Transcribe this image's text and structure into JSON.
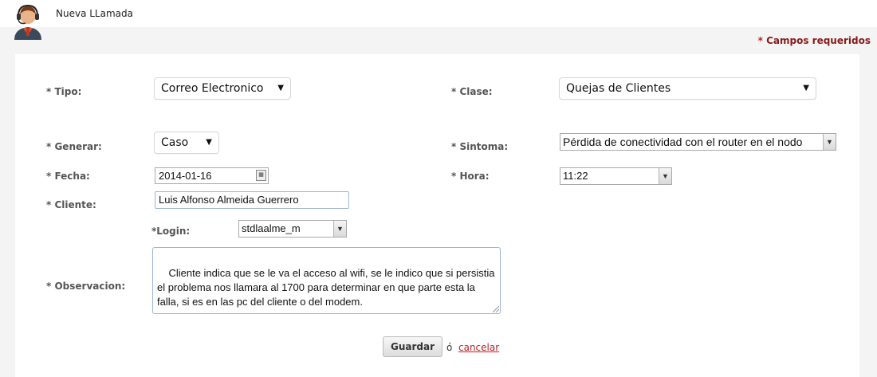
{
  "app": {
    "title": "Nueva LLamada",
    "avatar_icon": "operator-headset-icon"
  },
  "required_note": {
    "star": "*",
    "text": "Campos requeridos"
  },
  "form": {
    "tipo": {
      "label": "* Tipo:",
      "value": "Correo Electronico"
    },
    "clase": {
      "label": "* Clase:",
      "value": "Quejas de Clientes"
    },
    "generar": {
      "label": "* Generar:",
      "value": "Caso"
    },
    "sintoma": {
      "label": "* Sintoma:",
      "value": "Pérdida de conectividad con el router en el nodo"
    },
    "fecha": {
      "label": "* Fecha:",
      "value": "2014-01-16"
    },
    "hora": {
      "label": "* Hora:",
      "value": "11:22"
    },
    "cliente": {
      "label": "* Cliente:",
      "value": "Luis Alfonso Almeida Guerrero"
    },
    "login": {
      "label": "*Login:",
      "value": "stdlaalme_m"
    },
    "observacion": {
      "label": "* Observacion:",
      "value": "Cliente indica que se le va el acceso al wifi, se le indico que si persistia el problema nos llamara al 1700 para determinar en que parte esta la falla, si es en las pc del cliente o del modem."
    }
  },
  "actions": {
    "save_label": "Guardar",
    "or_text": "ó",
    "cancel_label": "cancelar"
  },
  "colors": {
    "required": "#8b1a1a",
    "link": "#bb2222",
    "accent_shirt": "#e0552a"
  }
}
